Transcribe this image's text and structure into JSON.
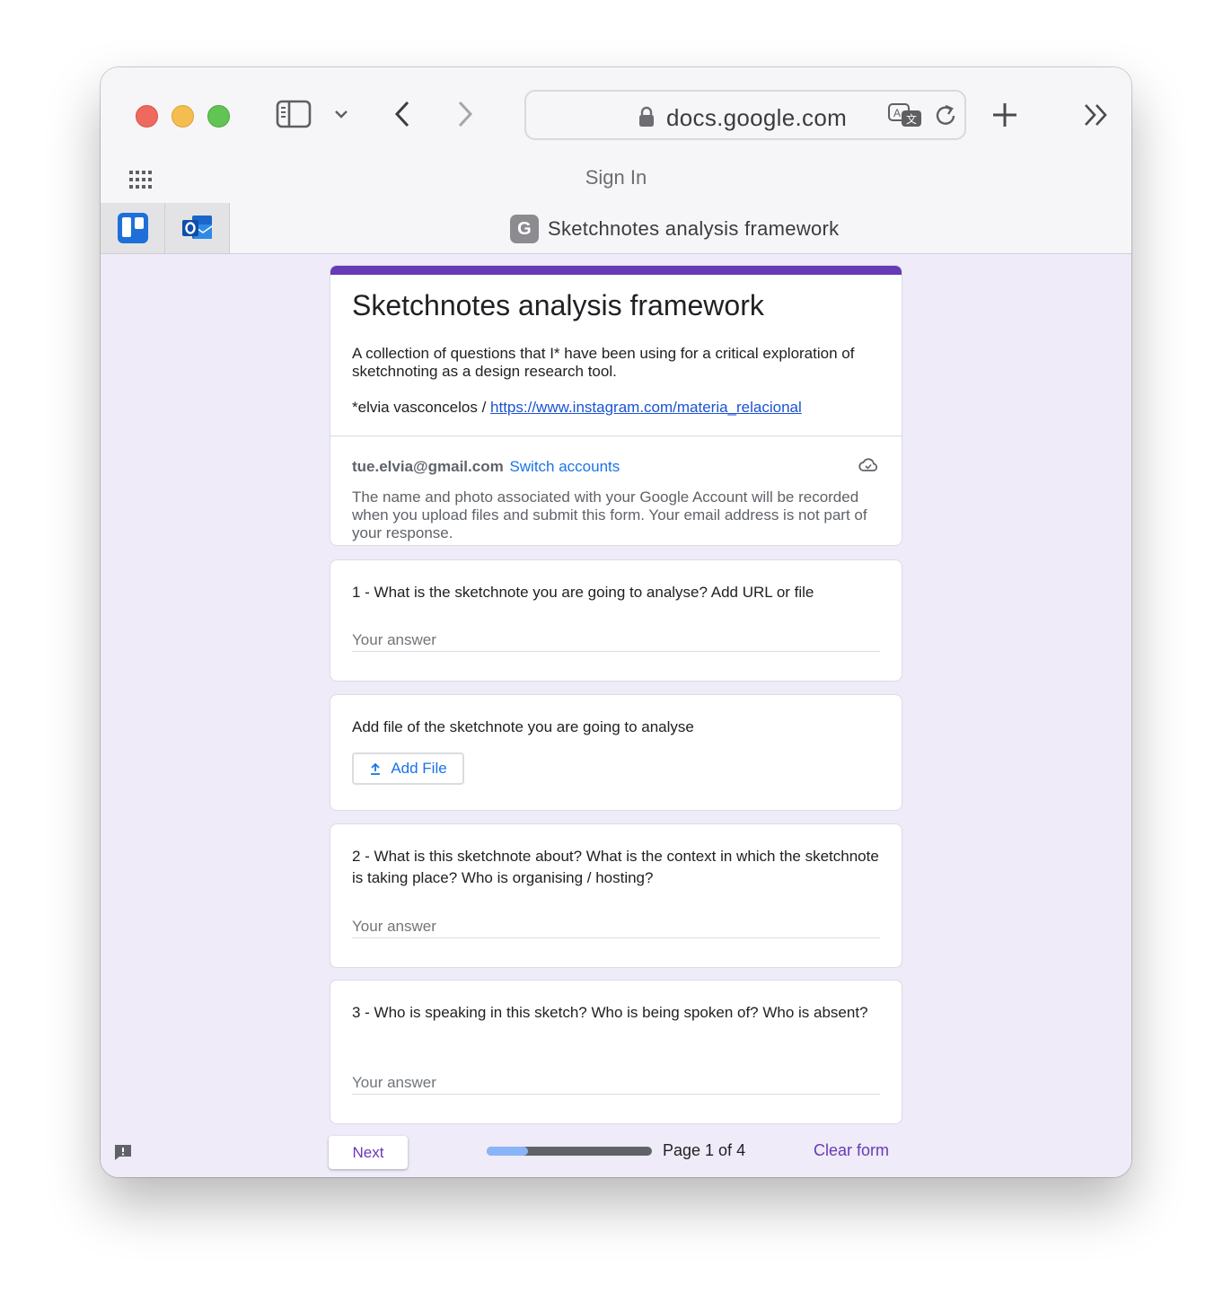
{
  "browser": {
    "url": "docs.google.com",
    "signin_label": "Sign In",
    "tab_title": "Sketchnotes analysis framework",
    "tab_favicon_letter": "G",
    "pinned_tabs": [
      "trello-icon",
      "outlook-icon"
    ]
  },
  "form": {
    "title": "Sketchnotes analysis framework",
    "description": "A collection of questions that I* have been using for a critical exploration of sketchnoting as a design research tool.",
    "author_prefix": "*elvia vasconcelos / ",
    "author_link": "https://www.instagram.com/materia_relacional",
    "account": {
      "email": "tue.elvia@gmail.com",
      "switch_label": "Switch accounts",
      "note": "The name and photo associated with your Google Account will be recorded when you upload files and submit this form. Your email address is not part of your response."
    },
    "questions": [
      {
        "text": "1 - What is the sketchnote you are going to analyse? Add URL or file",
        "placeholder": "Your answer"
      },
      {
        "text": "Add file of the sketchnote you are going to analyse",
        "button": "Add File"
      },
      {
        "text": "2 - What is this sketchnote about? What is the context in which the sketchnote is taking place? Who is organising / hosting?",
        "placeholder": "Your answer"
      },
      {
        "text": "3 - Who is speaking in this sketch? Who is being spoken of? Who is absent?",
        "placeholder": "Your answer"
      }
    ],
    "footer": {
      "next_label": "Next",
      "page_label": "Page 1 of 4",
      "progress_fraction": 0.25,
      "clear_label": "Clear form"
    }
  },
  "colors": {
    "accent": "#673ab7",
    "link": "#1a73e8",
    "background": "#efebf8"
  }
}
